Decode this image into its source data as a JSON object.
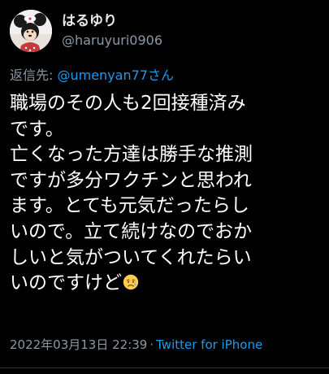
{
  "user": {
    "display_name": "はるゆり",
    "handle": "@haruyuri0906"
  },
  "reply": {
    "prefix": "返信先: ",
    "target": "@umenyan77さん"
  },
  "tweet": {
    "lines": [
      "職場のその人も2回接種済み",
      "です。",
      "亡くなった方達は勝手な推測",
      "ですが多分ワクチンと思われ",
      "ます。とても元気だったらし",
      "いので。立て続けなのでおか",
      "しいと気がついてくれたらい",
      "いのですけど"
    ],
    "emoji": "sad-but-relieved-face-icon"
  },
  "meta": {
    "timestamp": "2022年03月13日 22:39",
    "separator": "·",
    "source": "Twitter for iPhone"
  },
  "colors": {
    "background": "#000000",
    "text": "#ffffff",
    "secondary": "#8b98a5",
    "link": "#1d9bf0"
  }
}
